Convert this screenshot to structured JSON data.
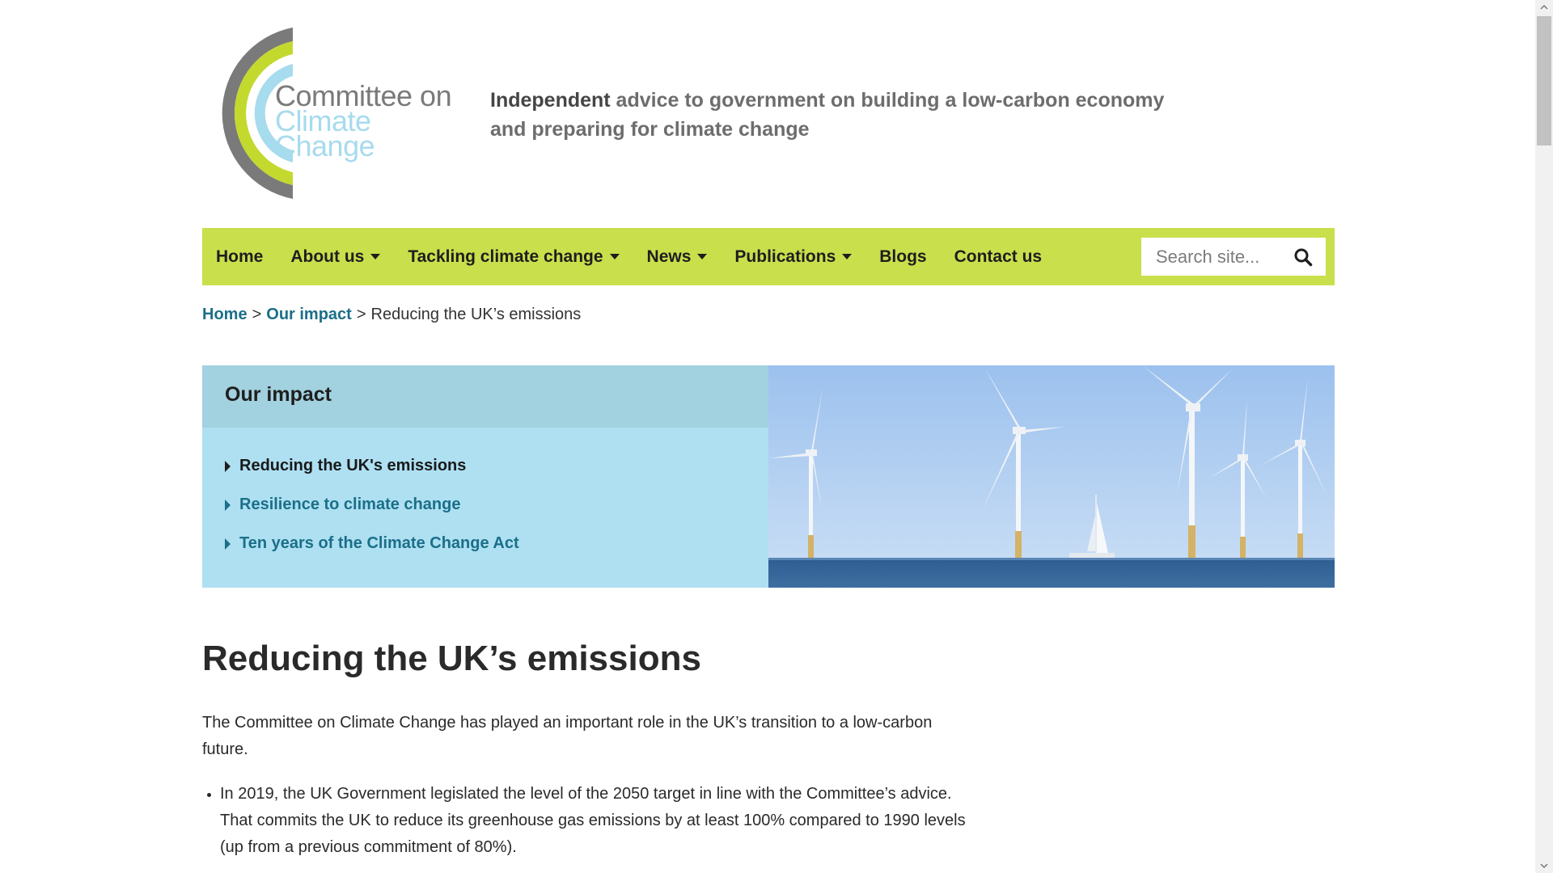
{
  "site": {
    "logo_line1": "Committee on",
    "logo_line2": "Climate Change",
    "tagline_bold": "Independent",
    "tagline_rest": " advice to government on building a low-carbon economy and preparing for climate change"
  },
  "nav": {
    "items": [
      {
        "label": "Home",
        "dropdown": false
      },
      {
        "label": "About us",
        "dropdown": true
      },
      {
        "label": "Tackling climate change",
        "dropdown": true
      },
      {
        "label": "News",
        "dropdown": true
      },
      {
        "label": "Publications",
        "dropdown": true
      },
      {
        "label": "Blogs",
        "dropdown": false
      },
      {
        "label": "Contact us",
        "dropdown": false
      }
    ],
    "search_placeholder": "Search site...",
    "search_icon": "search-icon"
  },
  "breadcrumb": {
    "home": "Home",
    "sep1": ">",
    "section": "Our impact",
    "sep2": ">",
    "current": "Reducing the UK’s emissions"
  },
  "impact": {
    "title": "Our impact",
    "items": [
      {
        "label": "Reducing the UK's emissions",
        "active": true
      },
      {
        "label": "Resilience to climate change",
        "active": false
      },
      {
        "label": "Ten years of the Climate Change Act",
        "active": false
      }
    ]
  },
  "article": {
    "heading": "Reducing the UK’s emissions",
    "intro": "The Committee on Climate Change has played an important role in the UK’s transition to a low-carbon future.",
    "bullet1": "In 2019, the UK Government legislated the level of the 2050 target in line with the Committee’s advice. That commits the UK to reduce its greenhouse gas emissions by at least 100% compared to 1990 levels (up from a previous commitment of 80%)."
  },
  "colors": {
    "nav_bg": "#cadf4c",
    "panel_bg": "#aee0f2",
    "panel_head": "#a2d1df",
    "link": "#1b6f88",
    "logo_grey": "#7a7a7a",
    "logo_green": "#c4d92e",
    "logo_blue": "#a7dbee"
  }
}
